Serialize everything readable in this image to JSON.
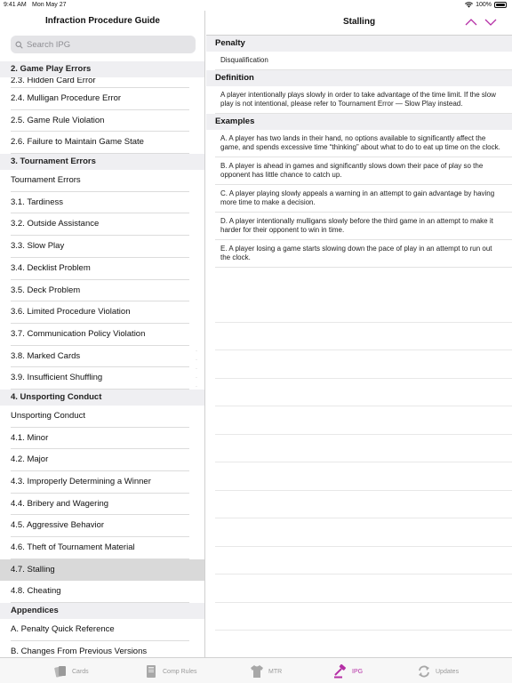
{
  "status": {
    "time": "9:41 AM",
    "date": "Mon May 27",
    "battery": "100%"
  },
  "sidebar": {
    "title": "Infraction Procedure Guide",
    "search_placeholder": "Search IPG",
    "items": [
      {
        "kind": "header",
        "label": "2. Game Play Errors"
      },
      {
        "kind": "clipped",
        "label": "2.3. Hidden Card Error"
      },
      {
        "kind": "row",
        "label": "2.4. Mulligan Procedure Error"
      },
      {
        "kind": "row",
        "label": "2.5. Game Rule Violation"
      },
      {
        "kind": "row",
        "label": "2.6. Failure to Maintain Game State"
      },
      {
        "kind": "header",
        "label": "3. Tournament Errors"
      },
      {
        "kind": "row",
        "label": "Tournament Errors"
      },
      {
        "kind": "row",
        "label": "3.1. Tardiness"
      },
      {
        "kind": "row",
        "label": "3.2. Outside Assistance"
      },
      {
        "kind": "row",
        "label": "3.3. Slow Play"
      },
      {
        "kind": "row",
        "label": "3.4. Decklist Problem"
      },
      {
        "kind": "row",
        "label": "3.5. Deck Problem"
      },
      {
        "kind": "row",
        "label": "3.6. Limited Procedure Violation"
      },
      {
        "kind": "row",
        "label": "3.7. Communication Policy Violation"
      },
      {
        "kind": "row",
        "label": "3.8. Marked Cards"
      },
      {
        "kind": "row",
        "label": "3.9. Insufficient Shuffling"
      },
      {
        "kind": "header",
        "label": "4. Unsporting Conduct"
      },
      {
        "kind": "row",
        "label": "Unsporting Conduct"
      },
      {
        "kind": "row",
        "label": "4.1. Minor"
      },
      {
        "kind": "row",
        "label": "4.2. Major"
      },
      {
        "kind": "row",
        "label": "4.3. Improperly Determining a Winner"
      },
      {
        "kind": "row",
        "label": "4.4. Bribery and Wagering"
      },
      {
        "kind": "row",
        "label": "4.5. Aggressive Behavior"
      },
      {
        "kind": "row",
        "label": "4.6. Theft of Tournament Material"
      },
      {
        "kind": "row",
        "label": "4.7. Stalling",
        "selected": true
      },
      {
        "kind": "row",
        "label": "4.8. Cheating"
      },
      {
        "kind": "header",
        "label": "Appendices"
      },
      {
        "kind": "row",
        "label": "A. Penalty Quick Reference"
      },
      {
        "kind": "row",
        "label": "B. Changes From Previous Versions"
      }
    ]
  },
  "detail": {
    "title": "Stalling",
    "sections": [
      {
        "header": "Penalty",
        "items": [
          "Disqualification"
        ]
      },
      {
        "header": "Definition",
        "items": [
          "A player intentionally plays slowly in order to take advantage of the time limit. If the slow play is not intentional, please refer to Tournament Error — Slow Play instead."
        ]
      },
      {
        "header": "Examples",
        "items": [
          "A. A player has two lands in their hand, no options available to significantly affect the game, and spends excessive time “thinking” about what to do to eat up time on the clock.",
          "B. A player is ahead in games and significantly slows down their pace of play so the opponent has little chance to catch up.",
          "C. A player playing slowly appeals a warning in an attempt to gain advantage by having more time to make a decision.",
          "D. A player intentionally mulligans slowly before the third game in an attempt to make it harder for their opponent to win in time.",
          "E. A player losing a game starts slowing down the pace of play in an attempt to run out the clock."
        ]
      }
    ]
  },
  "tabs": [
    {
      "label": "Cards",
      "icon": "cards-icon",
      "active": false
    },
    {
      "label": "Comp Rules",
      "icon": "book-icon",
      "active": false
    },
    {
      "label": "MTR",
      "icon": "shirt-icon",
      "active": false
    },
    {
      "label": "IPG",
      "icon": "gavel-icon",
      "active": true
    },
    {
      "label": "Updates",
      "icon": "refresh-icon",
      "active": false
    }
  ],
  "colors": {
    "accent": "#b52fa6",
    "inactive": "#9a9a9a",
    "section_bg": "#efeff2",
    "selected_bg": "#d9d9d9"
  }
}
